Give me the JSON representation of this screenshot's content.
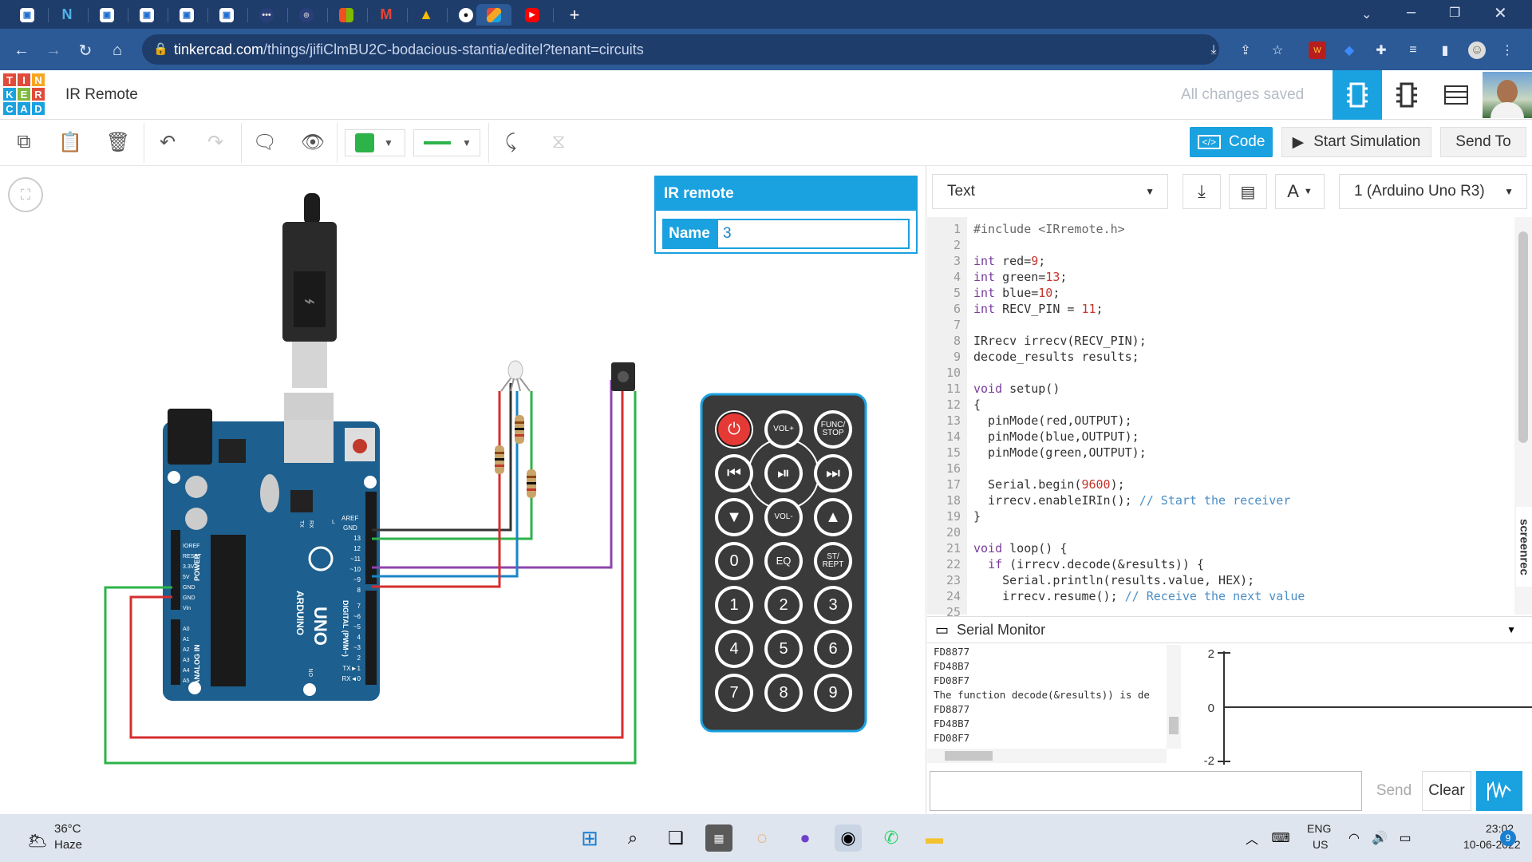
{
  "browser": {
    "url_host": "tinkercad.com",
    "url_path": "/things/jifiClmBU2C-bodacious-stantia/editel?tenant=circuits"
  },
  "header": {
    "logo_letters": [
      "T",
      "I",
      "N",
      "K",
      "E",
      "R",
      "C",
      "A",
      "D"
    ],
    "project_title": "IR Remote",
    "save_status": "All changes saved"
  },
  "toolbar": {
    "code_label": "Code",
    "start_sim_label": "Start Simulation",
    "send_to_label": "Send To",
    "fill_color": "#2db34a",
    "wire_color": "#2db34a"
  },
  "props_panel": {
    "title": "IR remote",
    "name_label": "Name",
    "name_value": "3"
  },
  "code_panel": {
    "mode": "Text",
    "board": "1 (Arduino Uno R3)",
    "line_numbers": [
      "1",
      "2",
      "3",
      "4",
      "5",
      "6",
      "7",
      "8",
      "9",
      "10",
      "11",
      "12",
      "13",
      "14",
      "15",
      "16",
      "17",
      "18",
      "19",
      "20",
      "21",
      "22",
      "23",
      "24",
      "25"
    ],
    "code_lines": [
      "#include <IRremote.h>",
      "",
      "int red=9;",
      "int green=13;",
      "int blue=10;",
      "int RECV_PIN = 11;",
      "",
      "IRrecv irrecv(RECV_PIN);",
      "decode_results results;",
      "",
      "void setup()",
      "{",
      "  pinMode(red,OUTPUT);",
      "  pinMode(blue,OUTPUT);",
      "  pinMode(green,OUTPUT);",
      "",
      "  Serial.begin(9600);",
      "  irrecv.enableIRIn(); // Start the receiver",
      "}",
      "",
      "void loop() {",
      "  if (irrecv.decode(&results)) {",
      "    Serial.println(results.value, HEX);",
      "    irrecv.resume(); // Receive the next value",
      ""
    ]
  },
  "serial_monitor": {
    "title": "Serial Monitor",
    "lines": [
      "FD8877",
      "FD48B7",
      "FD08F7",
      "The function decode(&results)) is de",
      "FD8877",
      "FD48B7",
      "FD08F7"
    ],
    "graph_labels": [
      "2",
      "0",
      "-2"
    ],
    "send_label": "Send",
    "clear_label": "Clear"
  },
  "remote": {
    "labels": {
      "vol_up": "VOL+",
      "func_stop_1": "FUNC/",
      "func_stop_2": "STOP",
      "vol_down": "VOL-",
      "eq": "EQ",
      "st_rept_1": "ST/",
      "st_rept_2": "REPT",
      "digits": [
        "0",
        "1",
        "2",
        "3",
        "4",
        "5",
        "6",
        "7",
        "8",
        "9"
      ]
    }
  },
  "board_labels": {
    "arduino": "ARDUINO",
    "uno": "UNO",
    "digital": "DIGITAL (PWM~)",
    "power": "POWER",
    "analog": "ANALOG IN",
    "aref": "AREF",
    "gnd": "GND",
    "pins_right": [
      "13",
      "12",
      "~11",
      "~10",
      "~9",
      "8",
      "7",
      "~6",
      "~5",
      "4",
      "~3",
      "2",
      "TX►1",
      "RX◄0"
    ],
    "pins_left": [
      "IOREF",
      "RESET",
      "3.3V",
      "5V",
      "GND",
      "GND",
      "Vin",
      "A0",
      "A1",
      "A2",
      "A3",
      "A4",
      "A5"
    ],
    "tx": "TX",
    "rx": "RX",
    "on": "ON",
    "l": "L"
  },
  "taskbar": {
    "temp": "36°C",
    "weather": "Haze",
    "lang1": "ENG",
    "lang2": "US",
    "time": "23:02",
    "date": "10-06-2022",
    "notifications": "9"
  },
  "screenrec_label": "screenrec"
}
